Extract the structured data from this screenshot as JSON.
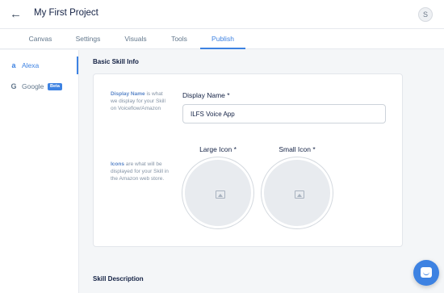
{
  "header": {
    "back_icon": "arrow-left-icon",
    "project_title": "My First Project",
    "avatar_initial": "S"
  },
  "tabs": [
    {
      "label": "Canvas"
    },
    {
      "label": "Settings"
    },
    {
      "label": "Visuals"
    },
    {
      "label": "Tools"
    },
    {
      "label": "Publish",
      "active": true
    }
  ],
  "sidebar": {
    "items": [
      {
        "label": "Alexa",
        "icon": "a",
        "active": true
      },
      {
        "label": "Google",
        "icon": "G",
        "badge": "Beta"
      }
    ]
  },
  "main": {
    "section_title": "Basic Skill Info",
    "display_name_help_bold": "Display Name",
    "display_name_help_rest": " is what we display for your Skill on Voiceflow/Amazon",
    "display_name_label": "Display Name *",
    "display_name_value": "ILFS Voice App",
    "icons_help_bold": "Icons",
    "icons_help_rest": " are what will be displayed for your Skill in the Amazon web store.",
    "large_icon_label": "Large Icon *",
    "small_icon_label": "Small Icon *",
    "next_section_title": "Skill Description"
  },
  "colors": {
    "accent": "#3d82e2",
    "background": "#f4f6f8"
  }
}
